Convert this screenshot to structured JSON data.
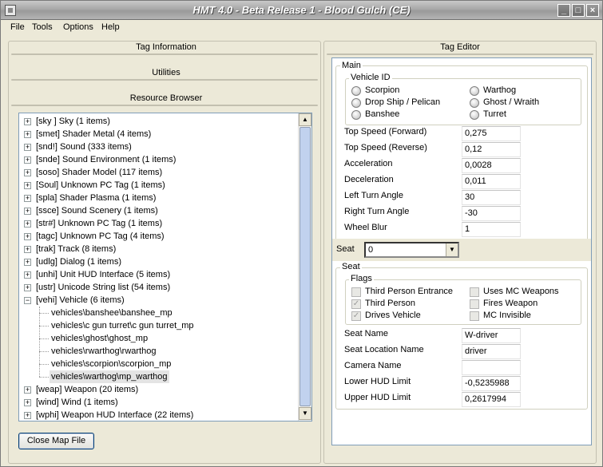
{
  "window": {
    "title": "HMT 4.0 - Beta Release 1 - Blood Gulch (CE)",
    "minimize_glyph": "_",
    "maximize_glyph": "□",
    "close_glyph": "×"
  },
  "menu": [
    "File",
    "Tools",
    "Options",
    "Help"
  ],
  "left_panel": {
    "tag_information": "Tag Information",
    "utilities": "Utilities",
    "resource_browser": "Resource Browser",
    "close_map_button": "Close Map File"
  },
  "tree": {
    "expander_collapsed": "+",
    "expander_expanded": "−",
    "items": [
      {
        "label": "[sky ] Sky (1 items)",
        "level": 0,
        "expander": "+"
      },
      {
        "label": "[smet] Shader Metal (4 items)",
        "level": 0,
        "expander": "+"
      },
      {
        "label": "[snd!] Sound (333 items)",
        "level": 0,
        "expander": "+"
      },
      {
        "label": "[snde] Sound Environment (1 items)",
        "level": 0,
        "expander": "+"
      },
      {
        "label": "[soso] Shader Model (117 items)",
        "level": 0,
        "expander": "+"
      },
      {
        "label": "[Soul] Unknown PC Tag (1 items)",
        "level": 0,
        "expander": "+"
      },
      {
        "label": "[spla] Shader Plasma (1 items)",
        "level": 0,
        "expander": "+"
      },
      {
        "label": "[ssce] Sound Scenery (1 items)",
        "level": 0,
        "expander": "+"
      },
      {
        "label": "[str#] Unknown PC Tag (1 items)",
        "level": 0,
        "expander": "+"
      },
      {
        "label": "[tagc] Unknown PC Tag (4 items)",
        "level": 0,
        "expander": "+"
      },
      {
        "label": "[trak] Track (8 items)",
        "level": 0,
        "expander": "+"
      },
      {
        "label": "[udlg] Dialog (1 items)",
        "level": 0,
        "expander": "+"
      },
      {
        "label": "[unhi] Unit HUD Interface (5 items)",
        "level": 0,
        "expander": "+"
      },
      {
        "label": "[ustr] Unicode String list (54 items)",
        "level": 0,
        "expander": "+"
      },
      {
        "label": "[vehi] Vehicle (6 items)",
        "level": 0,
        "expander": "−"
      },
      {
        "label": "vehicles\\banshee\\banshee_mp",
        "level": 1
      },
      {
        "label": "vehicles\\c gun turret\\c gun turret_mp",
        "level": 1
      },
      {
        "label": "vehicles\\ghost\\ghost_mp",
        "level": 1
      },
      {
        "label": "vehicles\\rwarthog\\rwarthog",
        "level": 1
      },
      {
        "label": "vehicles\\scorpion\\scorpion_mp",
        "level": 1
      },
      {
        "label": "vehicles\\warthog\\mp_warthog",
        "level": 1,
        "selected": true
      },
      {
        "label": "[weap] Weapon (20 items)",
        "level": 0,
        "expander": "+"
      },
      {
        "label": "[wind] Wind (1 items)",
        "level": 0,
        "expander": "+"
      },
      {
        "label": "[wphi] Weapon HUD Interface (22 items)",
        "level": 0,
        "expander": "+"
      }
    ],
    "scroll_up": "▲",
    "scroll_down": "▼"
  },
  "tag_editor": {
    "title": "Tag Editor",
    "main_legend": "Main",
    "vehicle_id_legend": "Vehicle ID",
    "vehicle_options": [
      "Scorpion",
      "Warthog",
      "Drop Ship / Pelican",
      "Ghost / Wraith",
      "Banshee",
      "Turret"
    ],
    "fields": [
      {
        "label": "Top Speed (Forward)",
        "value": "0,275"
      },
      {
        "label": "Top Speed (Reverse)",
        "value": "0,12"
      },
      {
        "label": "Acceleration",
        "value": "0,0028"
      },
      {
        "label": "Deceleration",
        "value": "0,011"
      },
      {
        "label": "Left Turn Angle",
        "value": "30"
      },
      {
        "label": "Right Turn Angle",
        "value": "-30"
      },
      {
        "label": "Wheel Blur",
        "value": "1"
      }
    ],
    "seat_label": "Seat",
    "seat_value": "0",
    "seat_dropdown_arrow": "▼",
    "seat_legend": "Seat",
    "flags_legend": "Flags",
    "flags": [
      {
        "label": "Third Person Entrance",
        "checked": false
      },
      {
        "label": "Uses MC Weapons",
        "checked": false
      },
      {
        "label": "Third Person",
        "checked": true
      },
      {
        "label": "Fires Weapon",
        "checked": false
      },
      {
        "label": "Drives Vehicle",
        "checked": true
      },
      {
        "label": "MC Invisible",
        "checked": false
      }
    ],
    "check_mark": "✓",
    "seat_fields": [
      {
        "label": "Seat Name",
        "value": "W-driver"
      },
      {
        "label": "Seat Location Name",
        "value": "driver"
      },
      {
        "label": "Camera Name",
        "value": ""
      },
      {
        "label": "Lower HUD Limit",
        "value": "-0,5235988"
      },
      {
        "label": "Upper HUD Limit",
        "value": "0,2617994"
      }
    ]
  }
}
